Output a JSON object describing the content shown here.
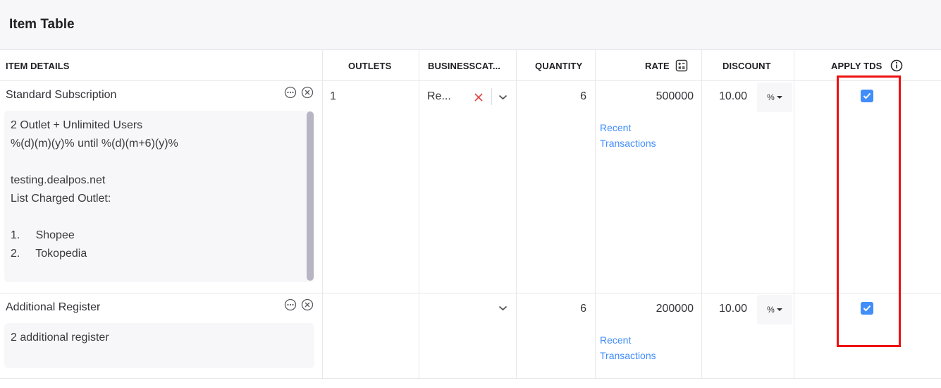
{
  "section": {
    "title": "Item Table"
  },
  "columns": {
    "item_details": "ITEM DETAILS",
    "outlets": "OUTLETS",
    "business_category": "BUSINESSCAT...",
    "quantity": "QUANTITY",
    "rate": "RATE",
    "discount": "DISCOUNT",
    "apply_tds": "APPLY TDS"
  },
  "rows": [
    {
      "item_name": "Standard Subscription",
      "description_lines": [
        "2 Outlet + Unlimited Users",
        "%(d)(m)(y)% until %(d)(m+6)(y)%",
        "",
        "testing.dealpos.net",
        "List Charged Outlet:",
        "",
        "1.     Shopee",
        "2.     Tokopedia"
      ],
      "outlets": "1",
      "business_category": "Re...",
      "quantity": "6",
      "rate": "500000",
      "recent_link_1": "Recent",
      "recent_link_2": "Transactions",
      "discount": "10.00",
      "discount_type": "%",
      "apply_tds": true
    },
    {
      "item_name": "Additional Register",
      "description_lines": [
        "2 additional register"
      ],
      "outlets": "",
      "business_category": "",
      "quantity": "6",
      "rate": "200000",
      "recent_link_1": "Recent",
      "recent_link_2": "Transactions",
      "discount": "10.00",
      "discount_type": "%",
      "apply_tds": true
    }
  ],
  "colors": {
    "accent": "#408dfb",
    "highlight": "#ee1111",
    "clear": "#e04545"
  }
}
